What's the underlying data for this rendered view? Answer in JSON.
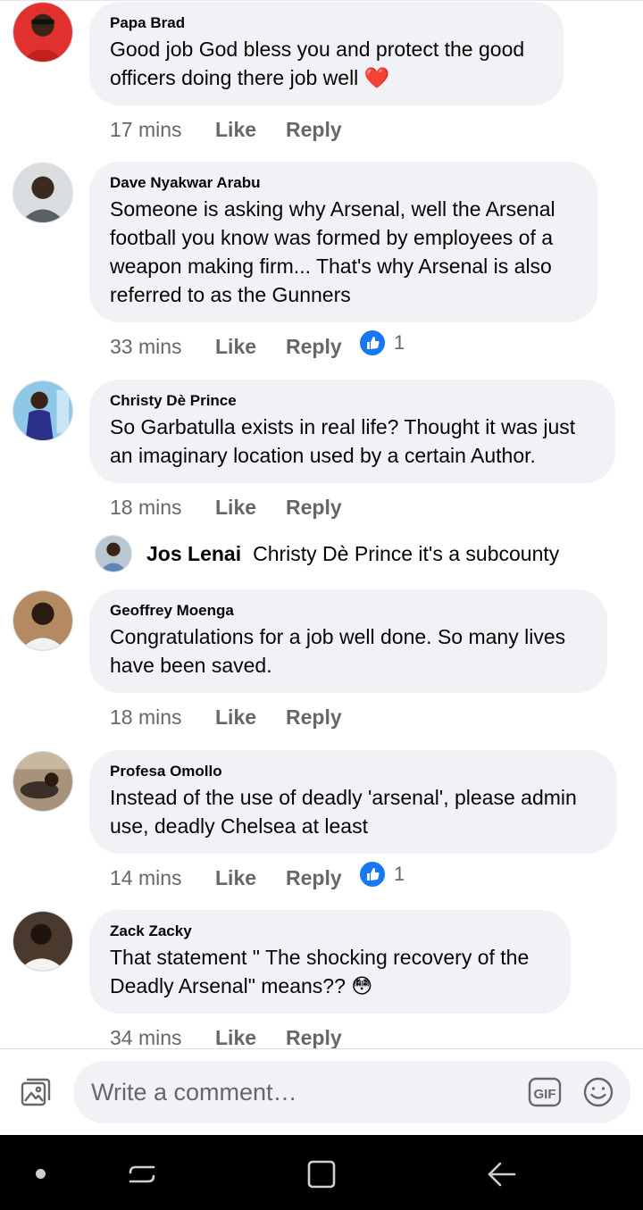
{
  "comments": [
    {
      "author": "Papa Brad",
      "text": "Good job God bless you and protect the good officers doing there job well ❤️",
      "time": "17 mins",
      "like": "Like",
      "reply": "Reply"
    },
    {
      "author": "Dave Nyakwar Arabu",
      "text": "Someone is asking why Arsenal, well the Arsenal football you know was formed by employees of a weapon making firm... That's why Arsenal is also referred to as the Gunners",
      "time": "33 mins",
      "like": "Like",
      "reply": "Reply",
      "reaction_count": "1"
    },
    {
      "author": "Christy Dè Prince",
      "text": "So Garbatulla exists in real life? Thought it was just an imaginary location used by a certain Author.",
      "time": "18 mins",
      "like": "Like",
      "reply": "Reply"
    },
    {
      "author": "Geoffrey Moenga",
      "text": "Congratulations for a job well done. So many lives have been saved.",
      "time": "18 mins",
      "like": "Like",
      "reply": "Reply"
    },
    {
      "author": "Profesa Omollo",
      "text": "Instead of the use of deadly 'arsenal', please admin use, deadly Chelsea at least",
      "time": "14 mins",
      "like": "Like",
      "reply": "Reply",
      "reaction_count": "1"
    },
    {
      "author": "Zack Zacky",
      "text": "That statement \" The shocking recovery of the Deadly Arsenal\" means?? 😳",
      "time": "34 mins",
      "like": "Like",
      "reply": "Reply"
    }
  ],
  "reply_preview": {
    "author": "Jos Lenai",
    "text": "Christy Dè Prince it's a subcounty"
  },
  "composer": {
    "placeholder": "Write a comment…",
    "gif_label": "GIF"
  },
  "colors": {
    "bubble": "#f0f2f5",
    "muted": "#65676b",
    "like_blue": "#1877f2"
  }
}
